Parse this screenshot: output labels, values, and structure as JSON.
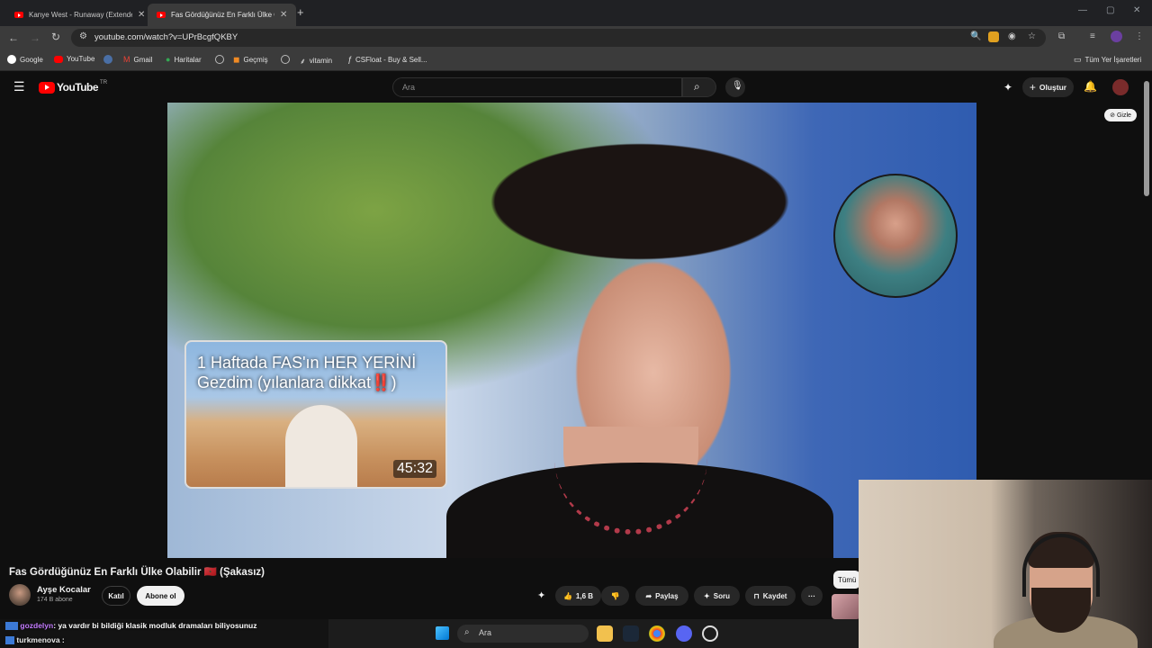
{
  "browser": {
    "tabs": [
      {
        "title": "Kanye West - Runaway (Extended",
        "active": false
      },
      {
        "title": "Fas Gördüğünüz En Farklı Ülke O",
        "active": true
      }
    ],
    "new_tab": "+",
    "url": "youtube.com/watch?v=UPrBcgfQKBY",
    "bookmarks": [
      "Google",
      "YouTube",
      "Gmail",
      "Haritalar",
      "Geçmiş",
      "vitamin",
      "CSFloat - Buy & Sell..."
    ],
    "all_bookmarks": "Tüm Yer İşaretleri"
  },
  "youtube": {
    "logo": "YouTube",
    "region": "TR",
    "search_placeholder": "Ara",
    "create_label": "Oluştur"
  },
  "video": {
    "hide_label": "Gizle",
    "endcard": {
      "title": "1 Haftada FAS'ın HER YERİNİ Gezdim (yılanlara dikkat‼️)",
      "duration": "45:32"
    },
    "title": "Fas Gördüğünüz En Farklı Ülke Olabilir 🇲🇦 (Şakasız)",
    "channel": "Ayşe Kocalar",
    "subscribers": "174 B abone",
    "join_label": "Katıl",
    "subscribe_label": "Abone ol",
    "likes": "1,6 B",
    "share_label": "Paylaş",
    "ask_label": "Soru",
    "save_label": "Kaydet",
    "more_label": "···",
    "chip_all": "Tümü"
  },
  "chat": [
    {
      "user": "gozdelyn",
      "message": "ya vardır bi bildiği klasik modluk dramaları biliyosunuz"
    },
    {
      "user": "turkmenova",
      "message": ""
    }
  ],
  "taskbar": {
    "search_placeholder": "Ara"
  }
}
